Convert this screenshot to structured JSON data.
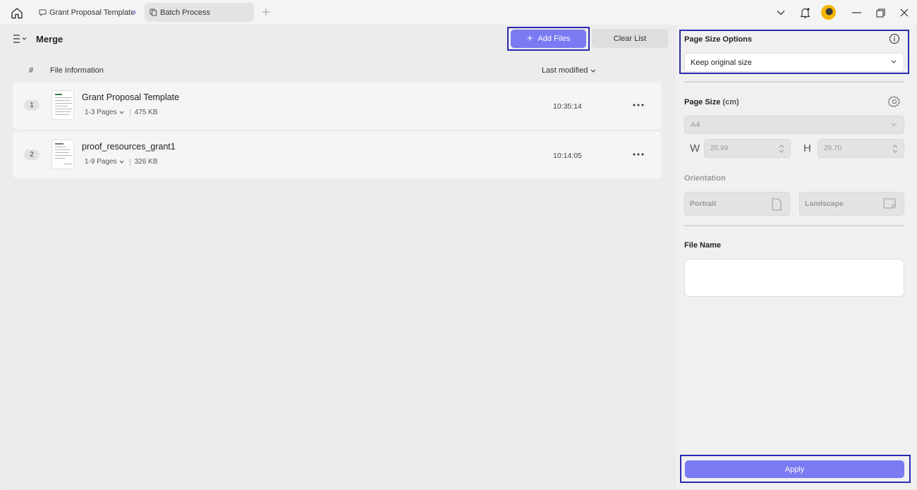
{
  "titlebar": {
    "tabs": [
      {
        "label": "Grant Proposal Template"
      },
      {
        "label": "Batch Process"
      }
    ]
  },
  "toolbar": {
    "title": "Merge",
    "add_files_label": "Add Files",
    "clear_list_label": "Clear List"
  },
  "table": {
    "headers": {
      "index": "#",
      "info": "File Information",
      "modified": "Last modified"
    },
    "rows": [
      {
        "index": "1",
        "name": "Grant Proposal Template",
        "pages": "1-3 Pages",
        "size": "475 KB",
        "time": "10:35:14"
      },
      {
        "index": "2",
        "name": "proof_resources_grant1",
        "pages": "1-9 Pages",
        "size": "326 KB",
        "time": "10:14:05"
      }
    ]
  },
  "settings": {
    "page_size_options_title": "Page Size Options",
    "page_size_option_value": "Keep original size",
    "page_size_title": "Page Size",
    "page_size_unit": "(cm)",
    "paper_value": "A4",
    "width_label": "W",
    "width_value": "20.99",
    "height_label": "H",
    "height_value": "29.70",
    "orientation_title": "Orientation",
    "portrait_label": "Portrait",
    "landscape_label": "Landscape",
    "file_name_title": "File Name",
    "file_name_value": "",
    "apply_label": "Apply"
  },
  "colors": {
    "accent": "#7a7af2",
    "highlight_frame": "#2a2ab2"
  }
}
